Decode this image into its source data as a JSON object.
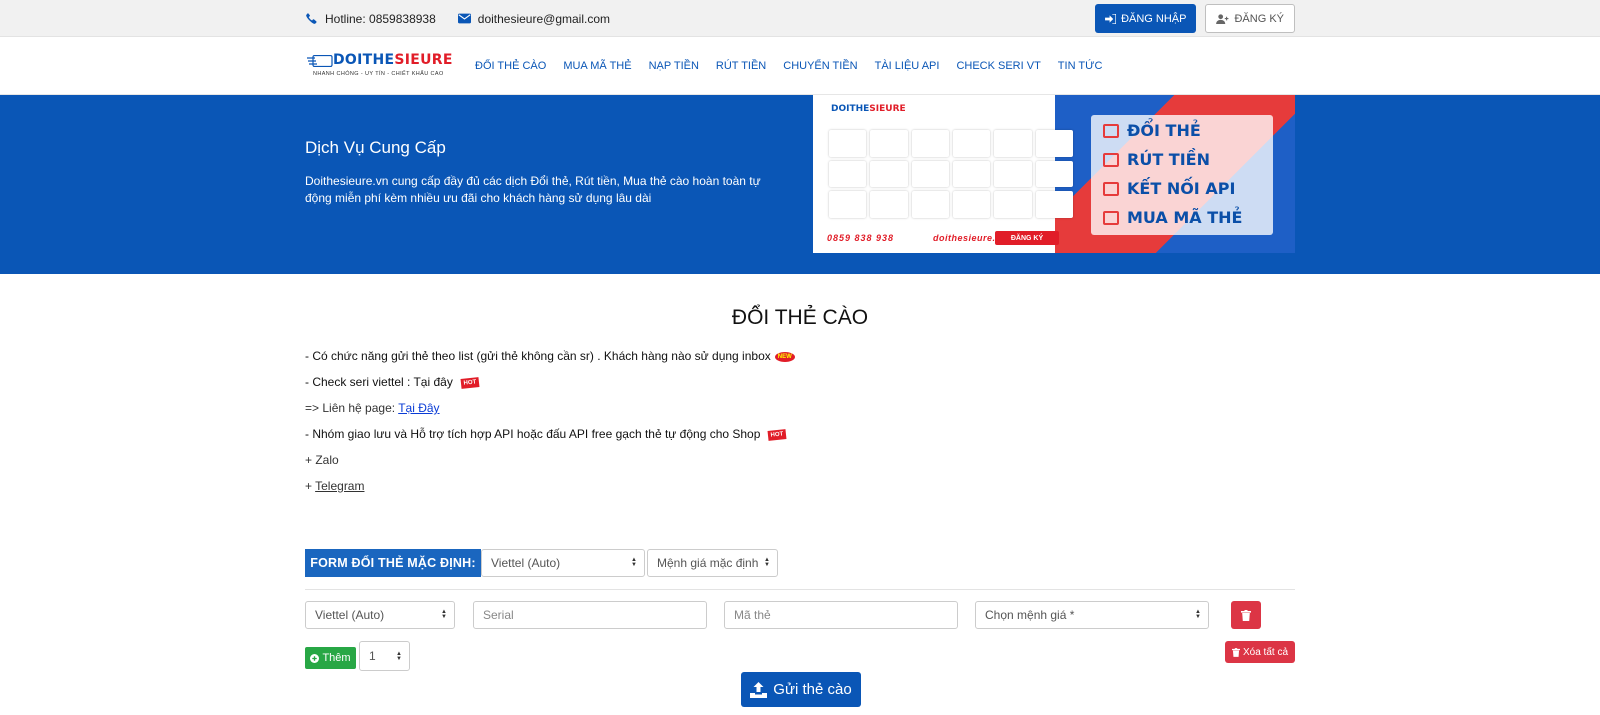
{
  "topbar": {
    "hotline": "Hotline: 0859838938",
    "email": "doithesieure@gmail.com",
    "login_label": "ĐĂNG NHẬP",
    "register_label": "ĐĂNG KÝ"
  },
  "logo": {
    "brand_blue": "DOITHE",
    "brand_red": "SIEURE",
    "slogan": "NHANH CHÓNG - UY TÍN - CHIẾT KHẤU CAO"
  },
  "nav": {
    "items": [
      "ĐỔI THẺ CÀO",
      "MUA MÃ THẺ",
      "NẠP TIỀN",
      "RÚT TIỀN",
      "CHUYỂN TIỀN",
      "TÀI LIỆU API",
      "CHECK SERI VT",
      "TIN TỨC"
    ]
  },
  "hero": {
    "title": "Dịch Vụ Cung Cấp",
    "description": "Doithesieure.vn cung cấp đầy đủ các dịch Đổi thẻ, Rút tiền, Mua thẻ cào hoàn toàn tự động miễn phí kèm nhiều ưu đãi cho khách hàng sử dụng lâu dài"
  },
  "banner": {
    "features": [
      "ĐỔI THẺ",
      "RÚT TIỀN",
      "KẾT NỐI API",
      "MUA MÃ THẺ"
    ],
    "phone": "0859 838 938",
    "site": "doithesieure.vn",
    "register": "ĐĂNG KÝ"
  },
  "main": {
    "title": "ĐỔI THẺ CÀO",
    "notes": {
      "list_feature": "- Có chức năng gửi thẻ theo list (gửi thẻ không cần sr) . Khách hàng nào sử dụng inbox",
      "check_seri": "- Check seri viettel  : Tại đây",
      "contact_prefix": "=> Liên hệ page: ",
      "contact_link": "Tại Đây",
      "group": "- Nhóm giao lưu và Hỗ trợ tích hợp API hoặc đấu API free  gạch thẻ tự động cho Shop",
      "zalo": "+ Zalo",
      "telegram_prefix": "+ ",
      "telegram": "Telegram",
      "new_badge": "NEW",
      "hot_badge": "HOT"
    },
    "form": {
      "label": "FORM ĐỔI THẺ MẶC ĐỊNH:",
      "default_telco": "Viettel (Auto)",
      "default_value": "Mệnh giá mặc định",
      "row_telco": "Viettel (Auto)",
      "serial_placeholder": "Serial",
      "code_placeholder": "Mã thẻ",
      "value_select": "Chọn mệnh giá *",
      "add_label": "Thêm",
      "qty": "1",
      "clear_label": "Xóa tất cả",
      "submit_label": "Gửi thẻ cào"
    }
  },
  "colors": {
    "primary": "#0a56b6",
    "danger": "#dc3545",
    "success": "#28a745"
  }
}
